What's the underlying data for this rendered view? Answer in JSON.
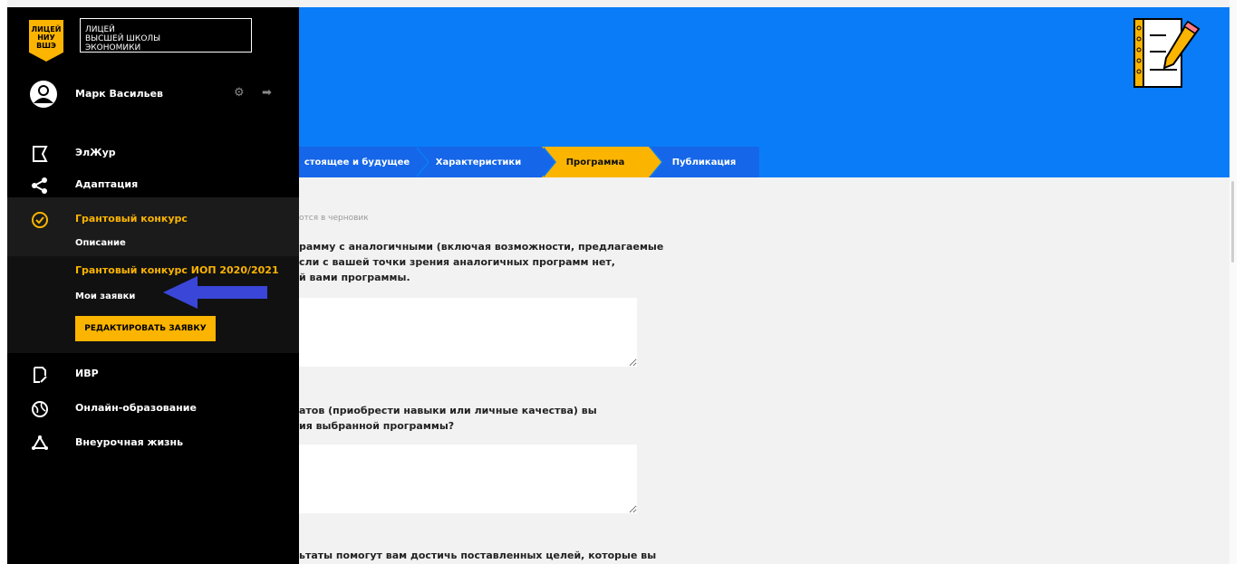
{
  "logo": {
    "badge_lines": [
      "ЛИЦЕЙ",
      "НИУ",
      "ВШЭ"
    ],
    "box_lines": [
      "ЛИЦЕЙ",
      "ВЫСШЕЙ ШКОЛЫ",
      "ЭКОНОМИКИ"
    ]
  },
  "user": {
    "name": "Марк Васильев"
  },
  "nav": {
    "eljur": "ЭлЖур",
    "adaptation": "Адаптация",
    "grant": "Грантовый конкурс",
    "description": "Описание",
    "grant_iop": "Грантовый конкурс ИОП 2020/2021",
    "my_applications": "Мои заявки",
    "edit_button": "РЕДАКТИРОВАТЬ ЗАЯВКУ",
    "ivr": "ИВР",
    "online": "Онлайн-образование",
    "extracurricular": "Внеурочная жизнь"
  },
  "steps": [
    "стоящее и будущее",
    "Характеристики",
    "Программа",
    "Публикация"
  ],
  "active_step": "Программа",
  "form": {
    "hint": "отся в черновик",
    "q1": "рамму с аналогичными (включая возможности, предлагаемые\nсли с вашей точки зрения аналогичных программ нет,\nй вами программы.",
    "q2": "атов (приобрести навыки или личные качества) вы\nия выбранной программы?",
    "q3": "ьтаты помогут вам достичь поставленных целей, которые вы"
  },
  "colors": {
    "banner": "#0a7cf8",
    "step": "#1566e8",
    "accent": "#fbb400",
    "sidebar": "#000000",
    "arrow": "#3a46d8"
  }
}
